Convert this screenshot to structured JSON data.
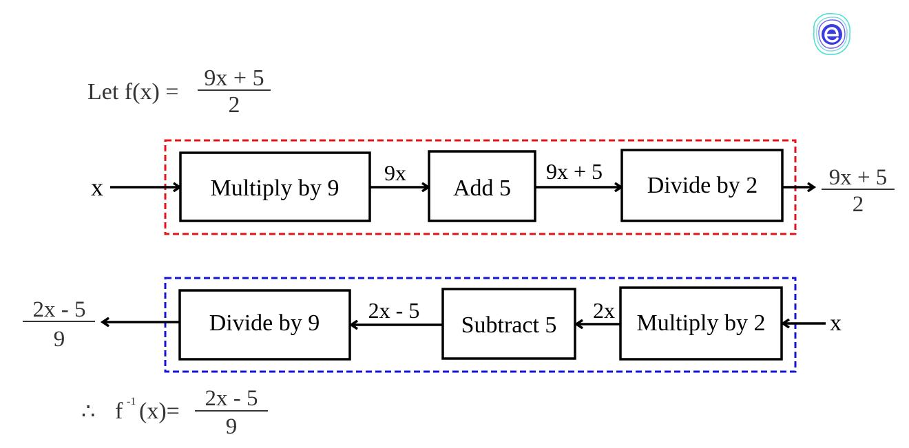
{
  "logo": {
    "name": "embibe-logo",
    "letter": "e",
    "colors": {
      "ring_outer": "#4fe0d0",
      "ring_inner": "#6a5cf0",
      "core": "#3b3be0"
    }
  },
  "definition": {
    "prefix": "Let f(x) =",
    "numerator": "9x + 5",
    "denominator": "2"
  },
  "forward": {
    "border_color": "#e0141b",
    "input": "x",
    "steps": [
      "Multiply by 9",
      "Add 5",
      "Divide by 2"
    ],
    "intermediates": [
      "9x",
      "9x + 5"
    ],
    "output": {
      "numerator": "9x + 5",
      "denominator": "2"
    }
  },
  "inverse": {
    "border_color": "#1414d2",
    "input": "x",
    "steps": [
      "Multiply by 2",
      "Subtract 5",
      "Divide by 9"
    ],
    "intermediates": [
      "2x",
      "2x - 5"
    ],
    "output": {
      "numerator": "2x - 5",
      "denominator": "9"
    }
  },
  "conclusion": {
    "therefore": "∴",
    "lhs_f": "f",
    "lhs_sup": "-1",
    "lhs_arg": "(x)=",
    "numerator": "2x - 5",
    "denominator": "9"
  }
}
